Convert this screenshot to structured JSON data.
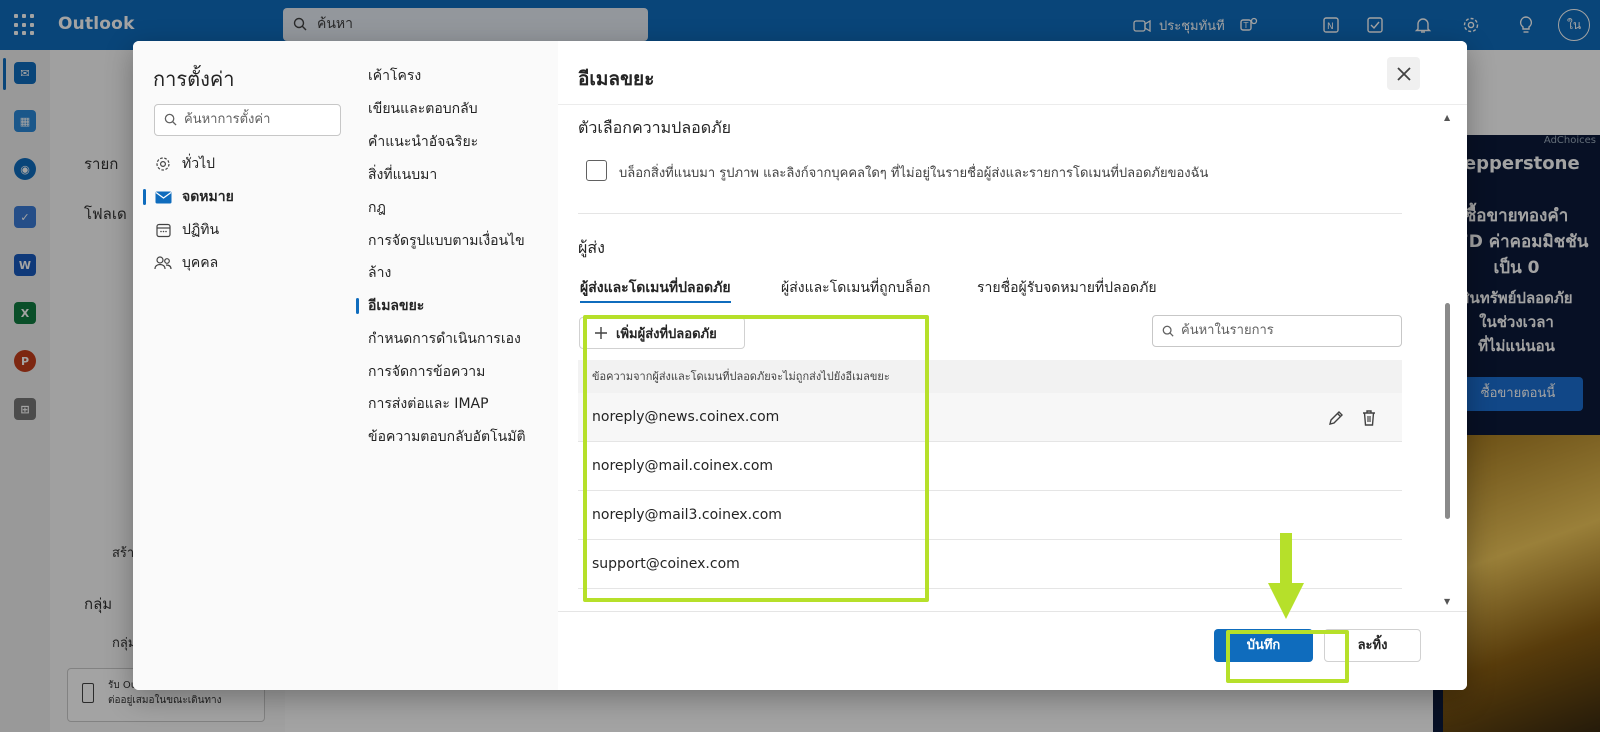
{
  "app": {
    "brand": "Outlook",
    "avatar_initials": "ใน"
  },
  "topbar": {
    "search_placeholder": "ค้นหา",
    "meet_now_label": "ประชุมทันที"
  },
  "background": {
    "folders": [
      "รายก",
      "โฟลเด",
      "กลุ่ม",
      "สร้า",
      "กลุ่ม"
    ],
    "promo_text": [
      "รับ Outlook ฟรีและเชื่อมต่อ",
      "ต่ออยู่เสมอในขณะเดินทาง"
    ]
  },
  "ad": {
    "choices": "AdChoices",
    "brand": "pepperstone",
    "lines": [
      "ซื้อขายทองคำ",
      "CFD ค่าคอมมิชชัน",
      "เป็น 0",
      "สินทรัพย์ปลอดภัย",
      "ในช่วงเวลา",
      "ที่ไม่แน่นอน"
    ],
    "cta": "ซื้อขายตอนนี้"
  },
  "settings": {
    "title": "การตั้งค่า",
    "search_placeholder": "ค้นหาการตั้งค่า",
    "categories": [
      {
        "label": "ทั่วไป",
        "icon": "gear-icon"
      },
      {
        "label": "จดหมาย",
        "icon": "mail-icon",
        "active": true
      },
      {
        "label": "ปฏิทิน",
        "icon": "calendar-icon"
      },
      {
        "label": "บุคคล",
        "icon": "people-icon"
      }
    ],
    "mail_sections": [
      "เค้าโครง",
      "เขียนและตอบกลับ",
      "คำแนะนำอัจฉริยะ",
      "สิ่งที่แนบมา",
      "กฎ",
      "การจัดรูปแบบตามเงื่อนไข",
      "ล้าง",
      "อีเมลขยะ",
      "กำหนดการดำเนินการเอง",
      "การจัดการข้อความ",
      "การส่งต่อและ IMAP",
      "ข้อความตอบกลับอัตโนมัติ"
    ],
    "active_section": "อีเมลขยะ"
  },
  "junk": {
    "title": "อีเมลขยะ",
    "safety_heading": "ตัวเลือกความปลอดภัย",
    "block_checkbox_label": "บล็อกสิ่งที่แนบมา รูปภาพ และลิงก์จากบุคคลใดๆ ที่ไม่อยู่ในรายชื่อผู้ส่งและรายการโดเมนที่ปลอดภัยของฉัน",
    "block_checked": false,
    "senders_heading": "ผู้ส่ง",
    "tabs": [
      "ผู้ส่งและโดเมนที่ปลอดภัย",
      "ผู้ส่งและโดเมนที่ถูกบล็อก",
      "รายชื่อผู้รับจดหมายที่ปลอดภัย"
    ],
    "active_tab": 0,
    "add_button": "เพิ่มผู้ส่งที่ปลอดภัย",
    "list_search_placeholder": "ค้นหาในรายการ",
    "list_header": "ข้อความจากผู้ส่งและโดเมนที่ปลอดภัยจะไม่ถูกส่งไปยังอีเมลขยะ",
    "safe_senders": [
      "noreply@news.coinex.com",
      "noreply@mail.coinex.com",
      "noreply@mail3.coinex.com",
      "support@coinex.com"
    ],
    "save_button": "บันทึก",
    "discard_button": "ละทิ้ง"
  },
  "colors": {
    "accent": "#0f6cbd",
    "highlight": "#b6e02a"
  }
}
